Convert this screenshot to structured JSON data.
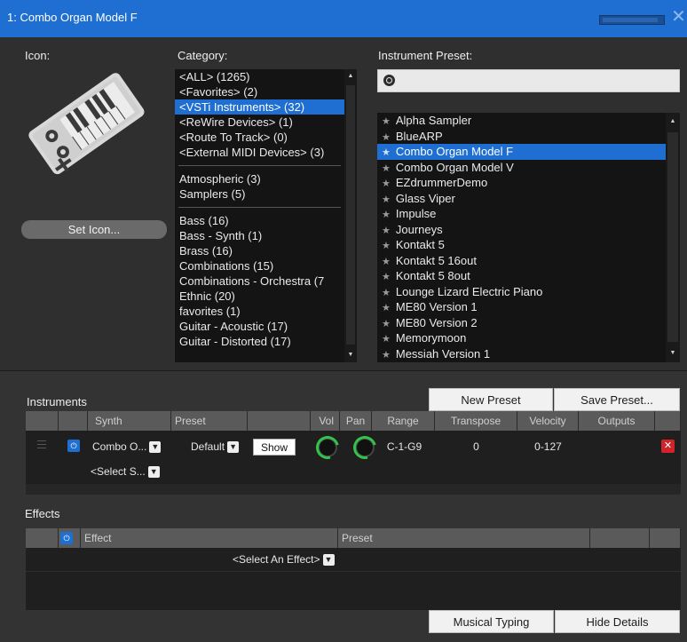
{
  "window": {
    "title": "1: Combo Organ Model F"
  },
  "top": {
    "icon_label": "Icon:",
    "category_label": "Category:",
    "preset_label": "Instrument Preset:",
    "set_icon_button": "Set Icon...",
    "categories_group1": [
      "<ALL> (1265)",
      "<Favorites> (2)",
      "<VSTi Instruments> (32)",
      "<ReWire Devices> (1)",
      "<Route To Track> (0)",
      "<External MIDI Devices> (3)"
    ],
    "categories_group2": [
      "Atmospheric (3)",
      "Samplers (5)"
    ],
    "categories_group3": [
      "Bass (16)",
      "Bass - Synth (1)",
      "Brass (16)",
      "Combinations (15)",
      "Combinations - Orchestra (7",
      "Ethnic (20)",
      "favorites (1)",
      "Guitar - Acoustic (17)",
      "Guitar - Distorted (17)"
    ],
    "selected_category": "<VSTi Instruments> (32)",
    "search": {
      "value": "",
      "placeholder": ""
    },
    "presets": [
      "Alpha Sampler",
      "BlueARP",
      "Combo Organ Model F",
      "Combo Organ Model V",
      "EZdrummerDemo",
      "Glass Viper",
      "Impulse",
      "Journeys",
      "Kontakt 5",
      "Kontakt 5 16out",
      "Kontakt 5 8out",
      "Lounge Lizard Electric Piano",
      "ME80 Version 1",
      "ME80 Version 2",
      "Memorymoon",
      "Messiah Version 1"
    ],
    "selected_preset": "Combo Organ Model F"
  },
  "instruments": {
    "label": "Instruments",
    "new_preset_button": "New Preset",
    "save_preset_button": "Save Preset...",
    "headers": {
      "synth": "Synth",
      "preset": "Preset",
      "vol": "Vol",
      "pan": "Pan",
      "range": "Range",
      "transpose": "Transpose",
      "velocity": "Velocity",
      "outputs": "Outputs"
    },
    "row": {
      "synth": "Combo O...",
      "preset": "Default",
      "show_button": "Show",
      "range": "C-1-G9",
      "transpose": "0",
      "velocity": "0-127"
    },
    "select_synth": "<Select S..."
  },
  "effects": {
    "label": "Effects",
    "headers": {
      "effect": "Effect",
      "preset": "Preset"
    },
    "select_effect": "<Select An Effect>"
  },
  "footer": {
    "musical_typing_button": "Musical Typing",
    "hide_details_button": "Hide Details"
  },
  "colors": {
    "accent": "#1e6fd1",
    "knob": "#34c24a",
    "delete": "#d0232a"
  },
  "icons": {
    "instrument_icon": "keyboard-synth-icon",
    "search": "search-icon",
    "power": "power-icon",
    "delete": "close-icon",
    "favorite": "star-icon"
  }
}
